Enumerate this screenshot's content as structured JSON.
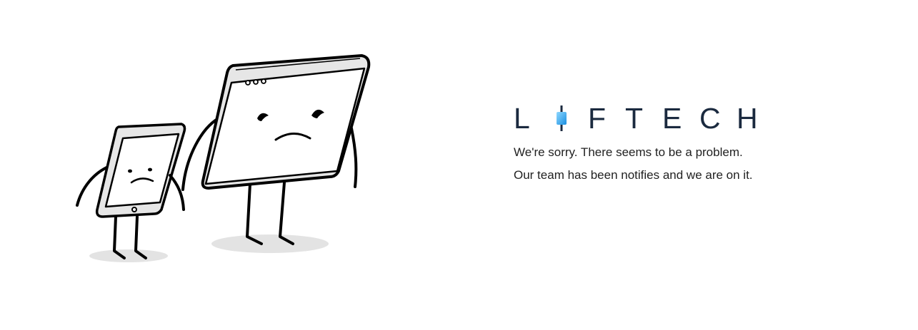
{
  "brand": {
    "logo_letters": [
      "L",
      "F",
      "T",
      "E",
      "C",
      "H"
    ],
    "logo_text": "LIFTECH",
    "accent_color": "#2aa7e8",
    "text_color": "#1b2a3f"
  },
  "error": {
    "line1": "We're sorry. There seems to be a problem.",
    "line2": "Our team has been notifies and we are on it."
  },
  "illustration": {
    "subject": "sad tablet and sad browser window holding hands"
  }
}
